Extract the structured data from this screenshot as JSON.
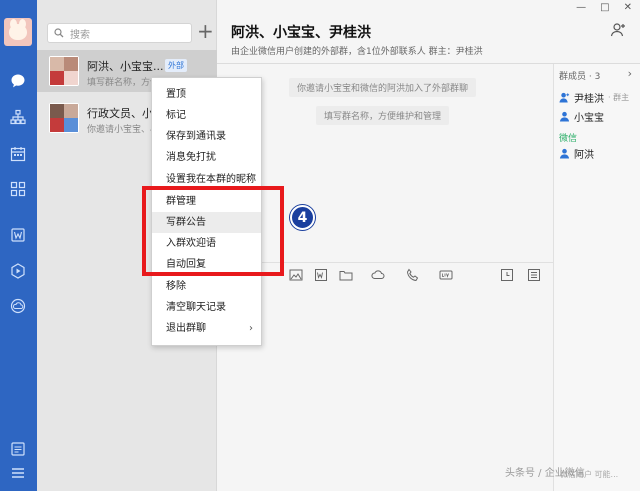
{
  "search": {
    "placeholder": "搜索"
  },
  "conversations": [
    {
      "name": "阿洪、小宝宝...",
      "tag": "外部",
      "preview": "填写群名称，方便...",
      "selected": true
    },
    {
      "name": "行政文员、小宝",
      "preview": "你邀请小宝宝、小"
    }
  ],
  "chat": {
    "title": "阿洪、小宝宝、尹桂洪",
    "subtitle": "由企业微信用户创建的外部群，含1位外部联系人 群主：尹桂洪",
    "system_messages": [
      "你邀请小宝宝和微信的阿洪加入了外部群聊",
      "填写群名称，方便维护和管理"
    ]
  },
  "window_controls": {
    "minimize": "—",
    "maximize": "□",
    "close": "✕"
  },
  "members": {
    "header": "群成员 · 3",
    "more": "›",
    "items": [
      {
        "name": "尹桂洪",
        "role": "· 群主"
      },
      {
        "name": "小宝宝",
        "role": ""
      }
    ],
    "wechat_group_label": "微信",
    "wechat_items": [
      {
        "name": "阿洪"
      }
    ],
    "footer": "微信用户 可能..."
  },
  "context_menu": {
    "items": [
      {
        "label": "置顶"
      },
      {
        "label": "标记"
      },
      {
        "label": "保存到通讯录"
      },
      {
        "label": "消息免打扰"
      },
      {
        "label": "设置我在本群的昵称"
      },
      {
        "label": "群管理"
      },
      {
        "label": "写群公告"
      },
      {
        "label": "入群欢迎语"
      },
      {
        "label": "自动回复"
      },
      {
        "label": "移除"
      },
      {
        "label": "清空聊天记录"
      },
      {
        "label": "退出群聊",
        "submenu": true
      }
    ],
    "chevron": "›"
  },
  "annotation": {
    "step_number": "4",
    "highlight_color": "#e8191c",
    "badge_color": "#1a3f9e"
  },
  "watermark": "头条号 / 企业微信",
  "colors": {
    "rail": "#2e66c2",
    "accent": "#2e74d6",
    "wechat_green": "#2aae67"
  }
}
